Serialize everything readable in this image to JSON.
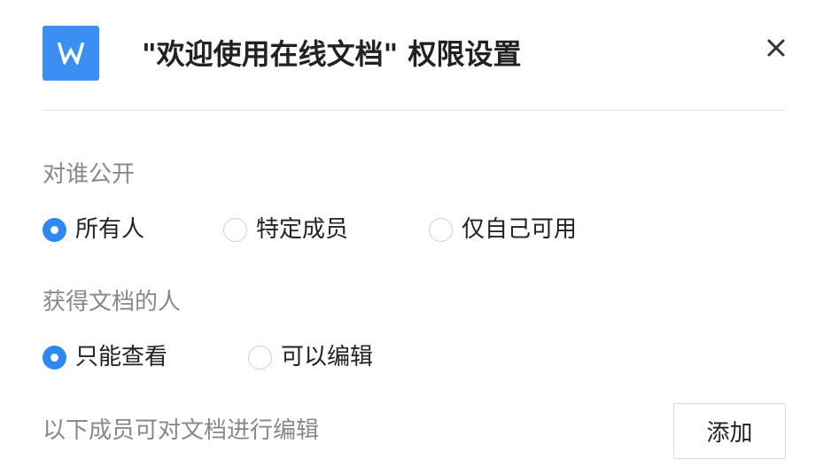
{
  "dialog": {
    "title": "\"欢迎使用在线文档\" 权限设置",
    "app_icon": "word-document-icon",
    "close_icon": "close-icon"
  },
  "visibility": {
    "label": "对谁公开",
    "options": [
      {
        "label": "所有人",
        "checked": true
      },
      {
        "label": "特定成员",
        "checked": false
      },
      {
        "label": "仅自己可用",
        "checked": false
      }
    ]
  },
  "recipients": {
    "label": "获得文档的人",
    "options": [
      {
        "label": "只能查看",
        "checked": true
      },
      {
        "label": "可以编辑",
        "checked": false
      }
    ]
  },
  "editors": {
    "label": "以下成员可对文档进行编辑",
    "add_button": "添加"
  },
  "colors": {
    "accent": "#2f88f0",
    "icon_bg": "#3b8ef2"
  }
}
